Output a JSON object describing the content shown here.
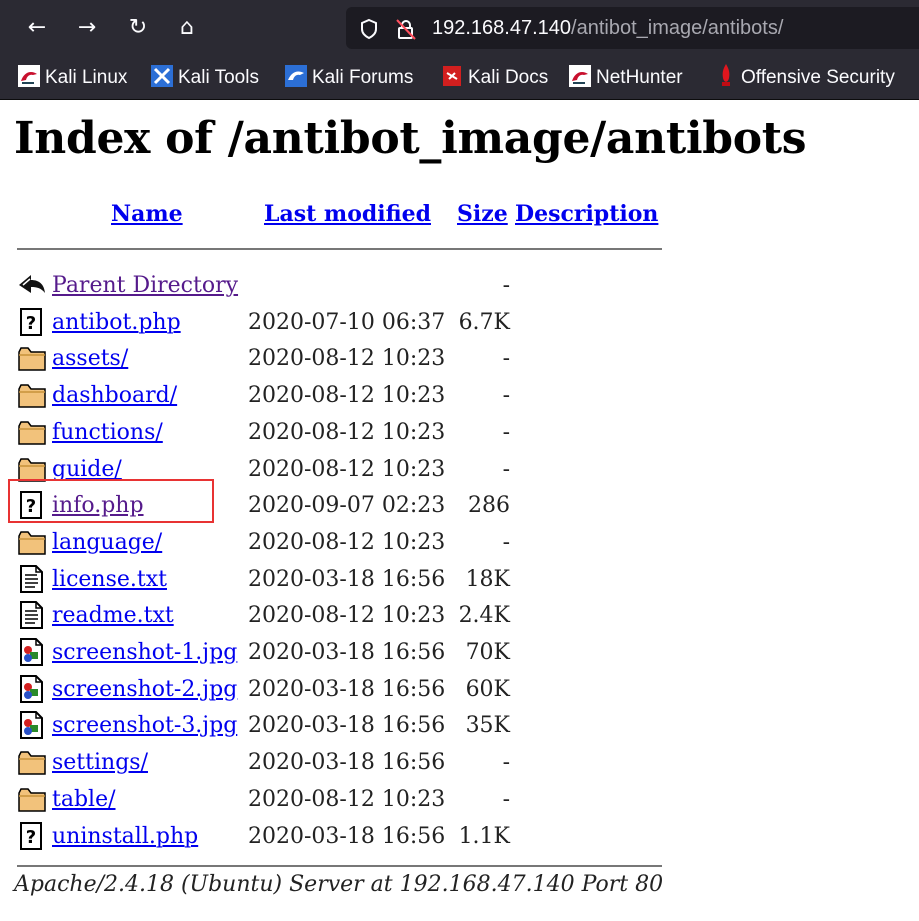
{
  "browser": {
    "url_host": "192.168.47.140",
    "url_path": "/antibot_image/antibots/",
    "nav_icons": {
      "back": "←",
      "forward": "→",
      "reload": "↻",
      "home": "⌂"
    },
    "bookmarks": [
      {
        "label": "Kali Linux",
        "icon": "kali-dragon-icon"
      },
      {
        "label": "Kali Tools",
        "icon": "kali-tools-icon"
      },
      {
        "label": "Kali Forums",
        "icon": "kali-forums-icon"
      },
      {
        "label": "Kali Docs",
        "icon": "kali-docs-icon"
      },
      {
        "label": "NetHunter",
        "icon": "kali-dragon-icon"
      },
      {
        "label": "Offensive Security",
        "icon": "offsec-icon"
      }
    ]
  },
  "page": {
    "title": "Index of /antibot_image/antibots",
    "columns": {
      "name": "Name",
      "modified": "Last modified",
      "size": "Size",
      "description": "Description"
    },
    "rows": [
      {
        "name": "Parent Directory",
        "modified": "",
        "size": "-",
        "icon": "back-icon"
      },
      {
        "name": "antibot.php",
        "modified": "2020-07-10 06:37",
        "size": "6.7K",
        "icon": "unknown-file-icon"
      },
      {
        "name": "assets/",
        "modified": "2020-08-12 10:23",
        "size": "-",
        "icon": "folder-icon"
      },
      {
        "name": "dashboard/",
        "modified": "2020-08-12 10:23",
        "size": "-",
        "icon": "folder-icon"
      },
      {
        "name": "functions/",
        "modified": "2020-08-12 10:23",
        "size": "-",
        "icon": "folder-icon"
      },
      {
        "name": "guide/",
        "modified": "2020-08-12 10:23",
        "size": "-",
        "icon": "folder-icon"
      },
      {
        "name": "info.php",
        "modified": "2020-09-07 02:23",
        "size": "286",
        "icon": "unknown-file-icon"
      },
      {
        "name": "language/",
        "modified": "2020-08-12 10:23",
        "size": "-",
        "icon": "folder-icon"
      },
      {
        "name": "license.txt",
        "modified": "2020-03-18 16:56",
        "size": "18K",
        "icon": "text-file-icon"
      },
      {
        "name": "readme.txt",
        "modified": "2020-08-12 10:23",
        "size": "2.4K",
        "icon": "text-file-icon"
      },
      {
        "name": "screenshot-1.jpg",
        "modified": "2020-03-18 16:56",
        "size": "70K",
        "icon": "image-file-icon"
      },
      {
        "name": "screenshot-2.jpg",
        "modified": "2020-03-18 16:56",
        "size": "60K",
        "icon": "image-file-icon"
      },
      {
        "name": "screenshot-3.jpg",
        "modified": "2020-03-18 16:56",
        "size": "35K",
        "icon": "image-file-icon"
      },
      {
        "name": "settings/",
        "modified": "2020-03-18 16:56",
        "size": "-",
        "icon": "folder-icon"
      },
      {
        "name": "table/",
        "modified": "2020-08-12 10:23",
        "size": "-",
        "icon": "folder-icon"
      },
      {
        "name": "uninstall.php",
        "modified": "2020-03-18 16:56",
        "size": "1.1K",
        "icon": "unknown-file-icon"
      }
    ],
    "footer": "Apache/2.4.18 (Ubuntu) Server at 192.168.47.140 Port 80"
  },
  "colors": {
    "link": "#0000ee",
    "visited": "#551a8b",
    "highlight": "#e83333",
    "toolbar": "#2b2a33"
  }
}
